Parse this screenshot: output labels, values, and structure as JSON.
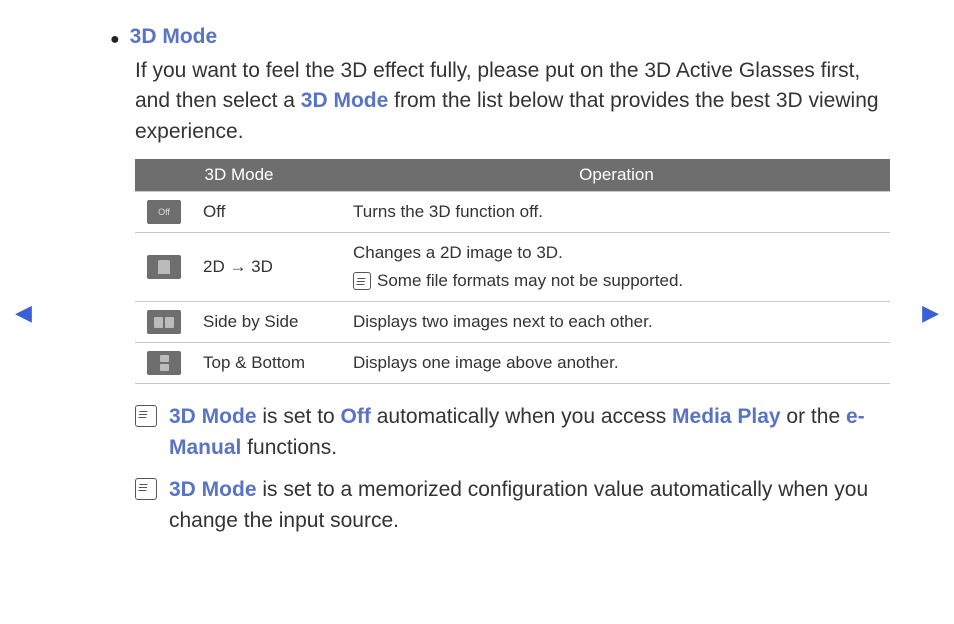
{
  "nav": {
    "prev": "◀",
    "next": "▶"
  },
  "section_title": "3D Mode",
  "intro": {
    "part1": "If you want to feel the 3D effect fully, please put on the 3D Active Glasses first, and then select a ",
    "kw": "3D Mode",
    "part2": " from the list below that provides the best 3D viewing experience."
  },
  "table": {
    "headers": {
      "mode": "3D Mode",
      "operation": "Operation"
    },
    "rows": [
      {
        "icon_label": "Off",
        "mode": "Off",
        "operation": "Turns the 3D function off."
      },
      {
        "icon_label": "2D→3D",
        "mode": "2D → 3D",
        "operation": "Changes a 2D image to 3D.",
        "sub_note": "Some file formats may not be supported."
      },
      {
        "icon_label": "sbs",
        "mode": "Side by Side",
        "operation": "Displays two images next to each other."
      },
      {
        "icon_label": "tb",
        "mode": "Top & Bottom",
        "operation": "Displays one image above another."
      }
    ]
  },
  "notes": [
    {
      "segments": [
        {
          "t": "3D Mode",
          "kw": true
        },
        {
          "t": " is set to "
        },
        {
          "t": "Off",
          "kw": true
        },
        {
          "t": " automatically when you access "
        },
        {
          "t": "Media Play",
          "kw": true
        },
        {
          "t": " or the "
        },
        {
          "t": "e-Manual",
          "kw": true
        },
        {
          "t": " functions."
        }
      ]
    },
    {
      "segments": [
        {
          "t": "3D Mode",
          "kw": true
        },
        {
          "t": " is set to a memorized configuration value automatically when you change the input source."
        }
      ]
    }
  ]
}
